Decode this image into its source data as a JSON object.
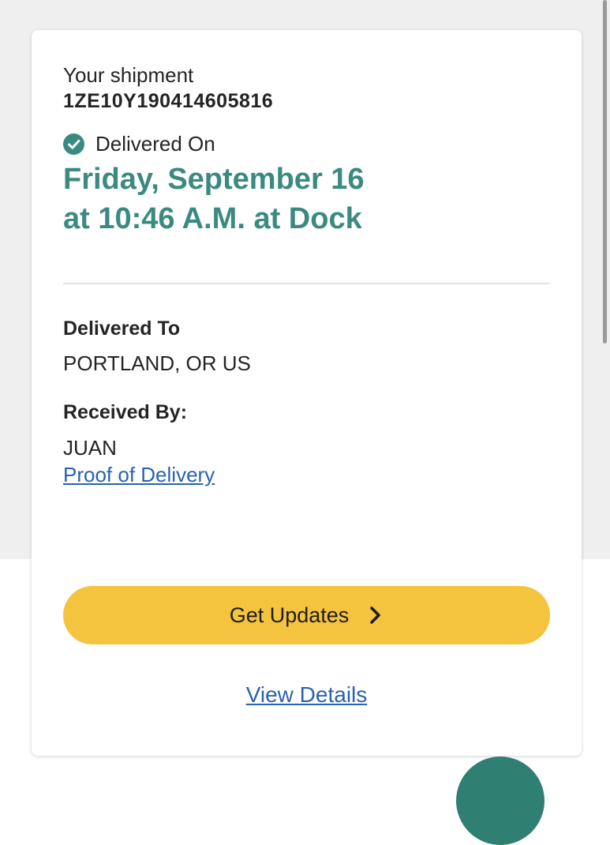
{
  "shipment": {
    "label": "Your shipment",
    "tracking_number": "1ZE10Y190414605816"
  },
  "status": {
    "icon": "check-circle-icon",
    "label": "Delivered On",
    "date_line1": "Friday, September 16",
    "date_line2": "at 10:46 A.M. at Dock"
  },
  "delivered_to": {
    "heading": "Delivered To",
    "value": "PORTLAND, OR US"
  },
  "received_by": {
    "heading": "Received By:",
    "value": "JUAN"
  },
  "links": {
    "proof_of_delivery": "Proof of Delivery",
    "view_details": "View Details"
  },
  "buttons": {
    "get_updates": "Get Updates",
    "get_updates_icon": "chevron-right-icon"
  },
  "colors": {
    "accent_teal": "#3a8a80",
    "button_yellow": "#f4c43e",
    "link_blue": "#2862b2",
    "background_gray": "#efefef"
  }
}
